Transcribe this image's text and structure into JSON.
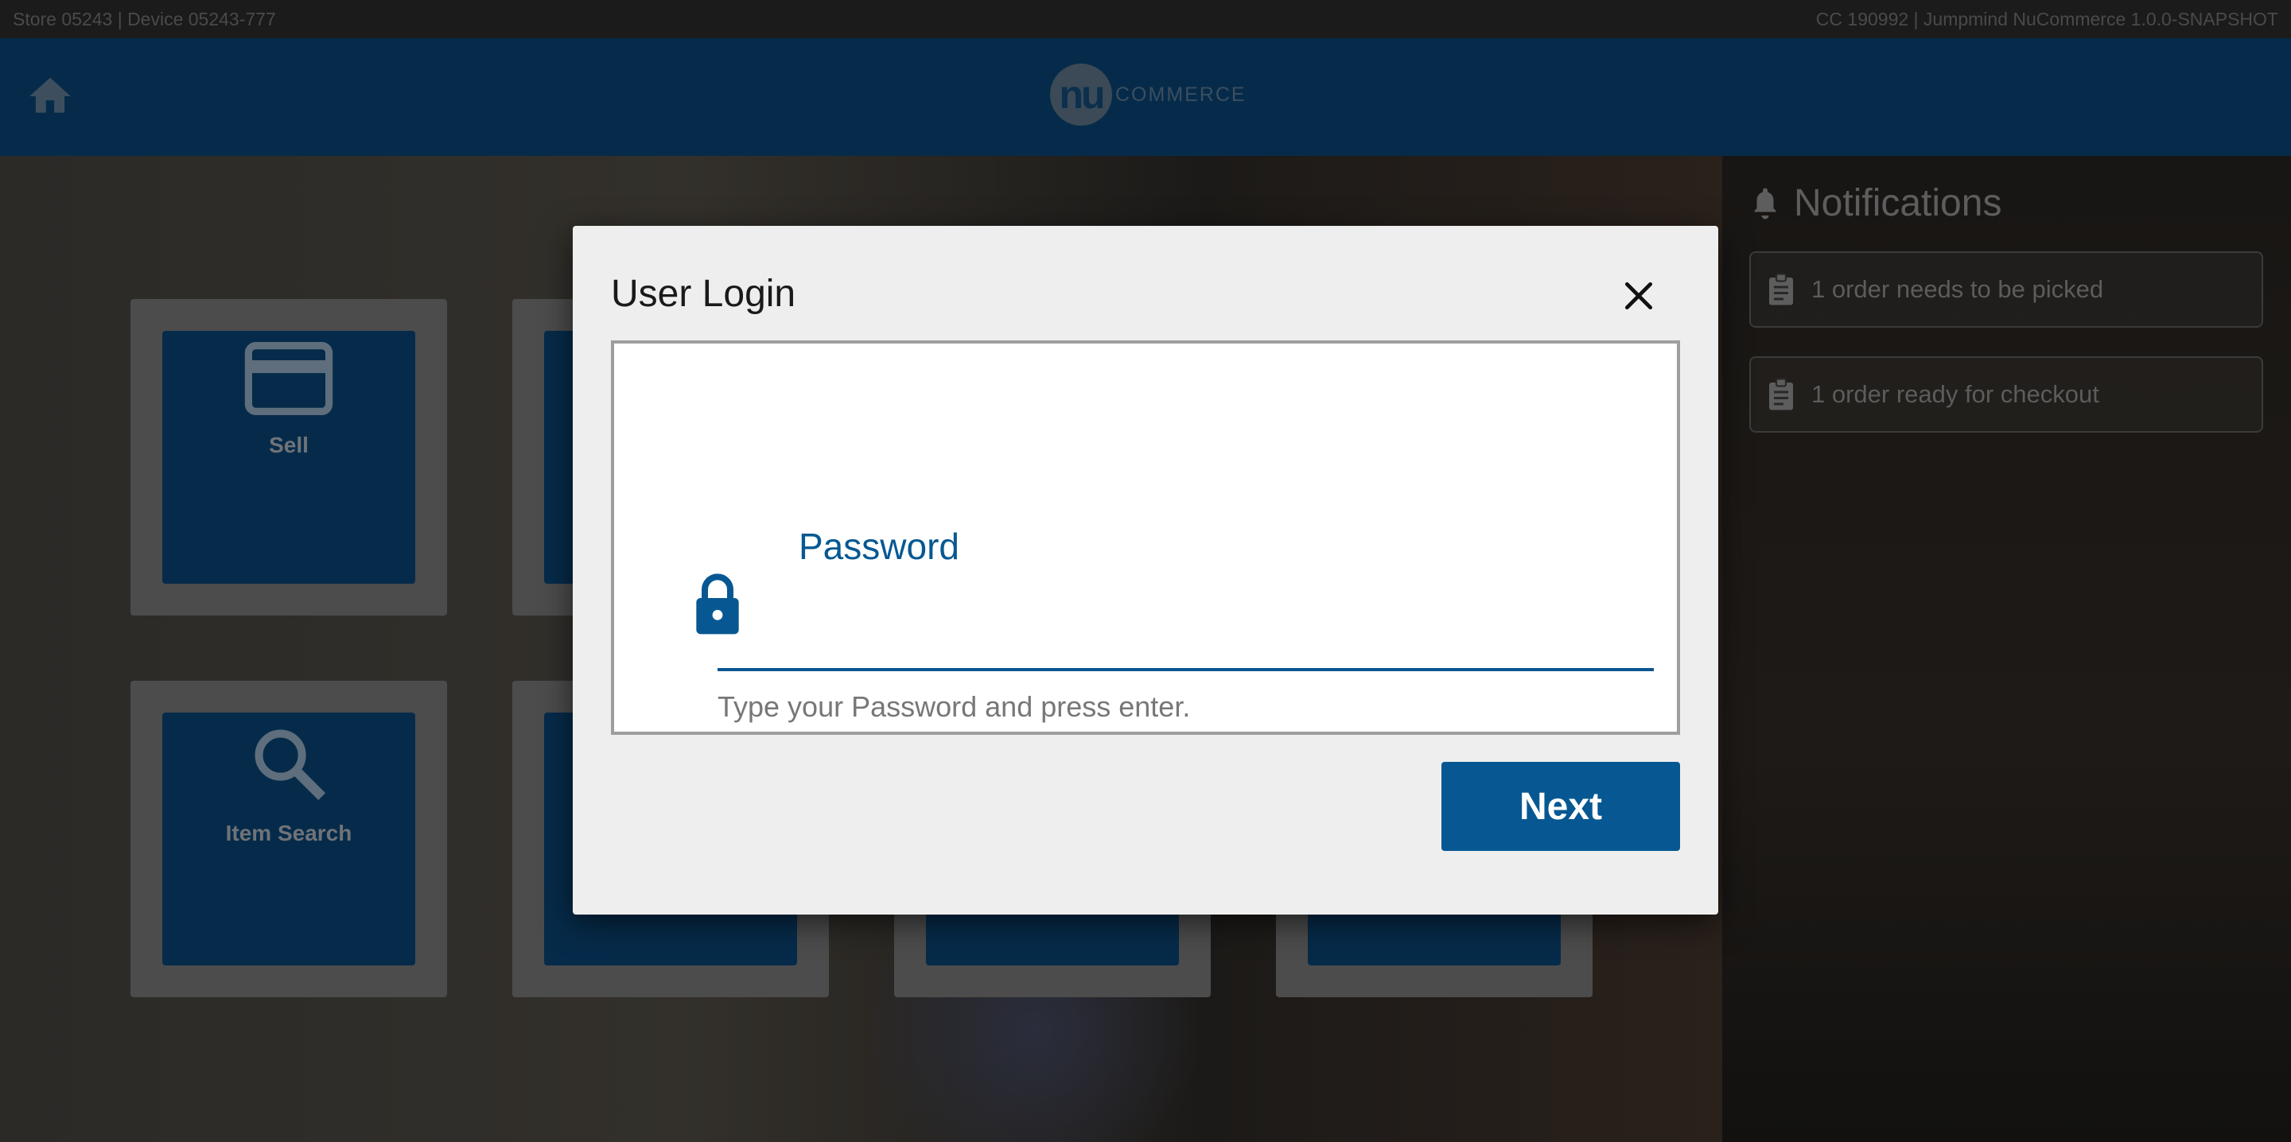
{
  "status_bar": {
    "left": "Store 05243 | Device 05243-777",
    "right": "CC 190992 | Jumpmind NuCommerce 1.0.0-SNAPSHOT"
  },
  "header": {
    "logo_mark": "nu",
    "logo_text": "COMMERCE"
  },
  "tiles": [
    {
      "label": "Sell",
      "icon": "credit-card-icon"
    },
    {
      "label": "",
      "icon": ""
    },
    {
      "label": "Item Search",
      "icon": "search-icon"
    },
    {
      "label": "",
      "icon": ""
    },
    {
      "label": "",
      "icon": ""
    },
    {
      "label": "",
      "icon": ""
    }
  ],
  "notifications": {
    "title": "Notifications",
    "items": [
      {
        "text": "1 order needs to be picked",
        "icon": "clipboard-icon"
      },
      {
        "text": "1 order ready for checkout",
        "icon": "clipboard-icon"
      }
    ]
  },
  "dialog": {
    "title": "User Login",
    "field_label": "Password",
    "field_value": "",
    "hint": "Type your Password and press enter.",
    "next_label": "Next"
  },
  "colors": {
    "brand_blue": "#075892",
    "header_bg": "#062b4a",
    "dialog_bg": "#eeeeee"
  }
}
